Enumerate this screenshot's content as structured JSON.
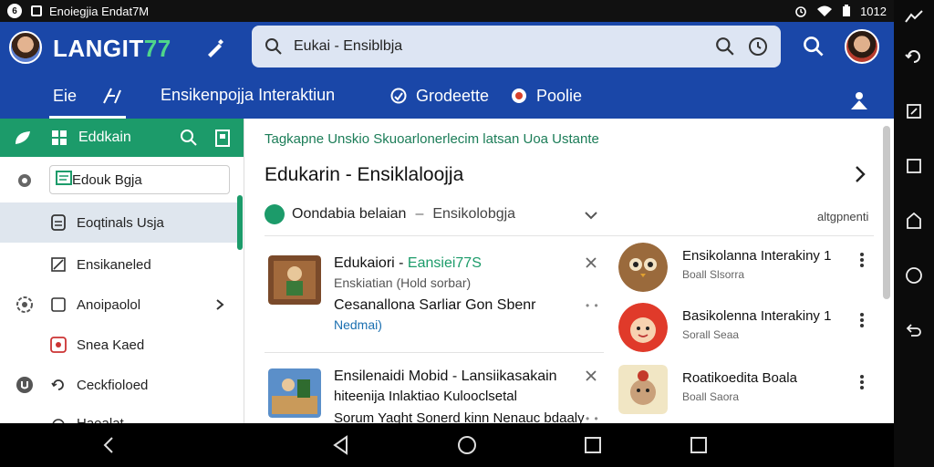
{
  "status_bar": {
    "badge": "6",
    "title": "Enoiegjia Endat7M",
    "time": "1012"
  },
  "header": {
    "logo_main": "LANGIT",
    "logo_accent": "77",
    "search_text": "Eukai - Ensiblbja"
  },
  "tabs": [
    {
      "label": "Eie"
    },
    {
      "label": "Ensikenpojja Interaktiun"
    },
    {
      "label": "Grodeette"
    },
    {
      "label": "Poolie"
    }
  ],
  "sidebar": {
    "head_label": "Eddkain",
    "input_value": "Edouk Bgja",
    "items": [
      {
        "label": "Eoqtinals Usja"
      },
      {
        "label": "Ensikaneled"
      },
      {
        "label": "Anoipaolol"
      },
      {
        "label": "Snea Kaed"
      },
      {
        "label": "Ceckfioloed"
      },
      {
        "label": "Haealat"
      }
    ]
  },
  "main": {
    "banner": "Tagkapne Unskio Skuoarlonerlecim latsan Uoa Ustante",
    "title": "Edukarin - Ensiklaloojja",
    "filter_label": "Oondabia belaian",
    "filter_separator": "–",
    "filter_value": "Ensikolobgja",
    "sort_label": "altgpnenti",
    "cards": [
      {
        "title_main": "Edukaiori - ",
        "title_accent": "Eansiei77S",
        "subtitle": "Enskiatian (Hold sorbar)",
        "desc": "Cesanallona Sarliar Gon Sbenr",
        "tag": "Nedmai)",
        "dots": "• •"
      },
      {
        "title_main": "Ensilenaidi Mobid - Lansiikasakain",
        "subtitle": "hiteenija Inlaktiao Kulooclsetal",
        "desc": "Sorum Yaght Sonerd kinn Nenauc bdaaly",
        "dots": "• •"
      }
    ],
    "list": [
      {
        "title": "Ensikolanna Interakiny 1",
        "sub": "Boall Slsorra"
      },
      {
        "title": "Basikolenna Interakiny 1",
        "sub": "Sorall Seaa"
      },
      {
        "title": "Roatikoedita Boala",
        "sub": "Boall Saora"
      }
    ]
  },
  "colors": {
    "header_blue": "#1a47a8",
    "accent_green": "#1c9b6a"
  }
}
